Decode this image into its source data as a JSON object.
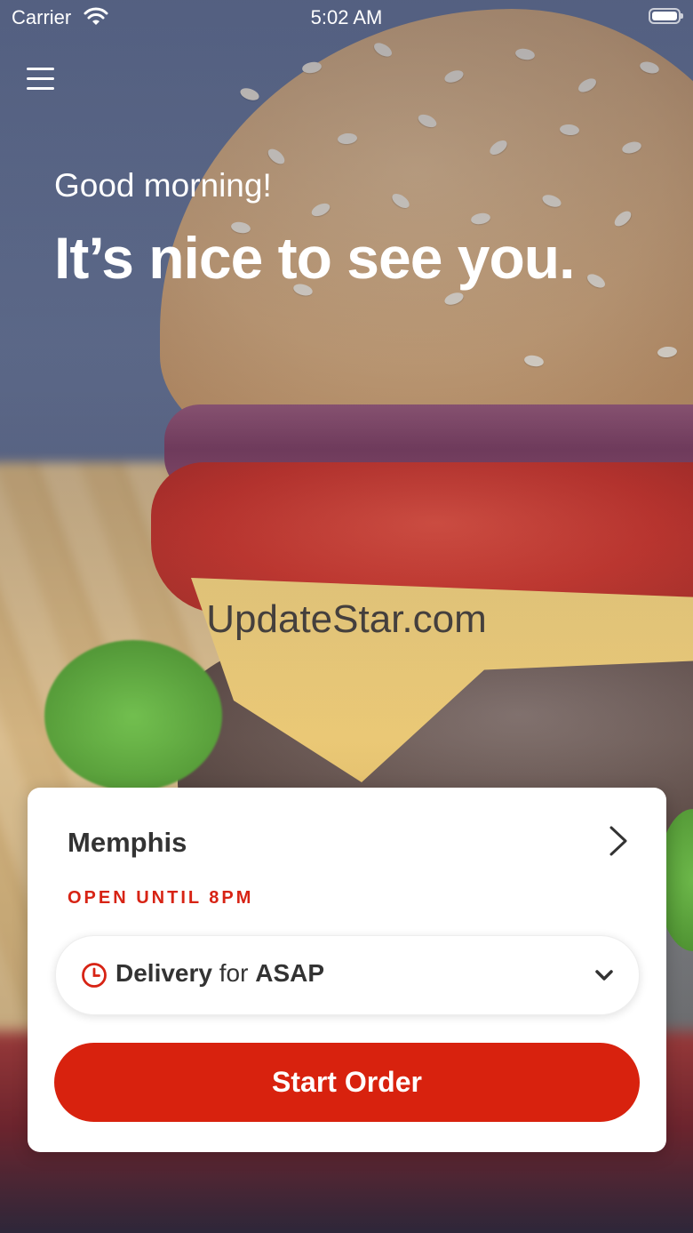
{
  "status_bar": {
    "carrier": "Carrier",
    "time": "5:02 AM"
  },
  "greeting": {
    "subtitle": "Good morning!",
    "headline": "It’s nice to see you."
  },
  "watermark": "UpdateStar.com",
  "order_card": {
    "store_name": "Memphis",
    "hours": "OPEN UNTIL 8PM",
    "delivery": {
      "mode": "Delivery",
      "connector": "for",
      "time": "ASAP"
    },
    "start_button": "Start Order"
  },
  "icons": [
    "menu-icon",
    "wifi-icon",
    "battery-icon",
    "chevron-right-icon",
    "clock-icon",
    "chevron-down-icon"
  ],
  "colors": {
    "accent": "#d8220e",
    "hours_text": "#d72314"
  }
}
